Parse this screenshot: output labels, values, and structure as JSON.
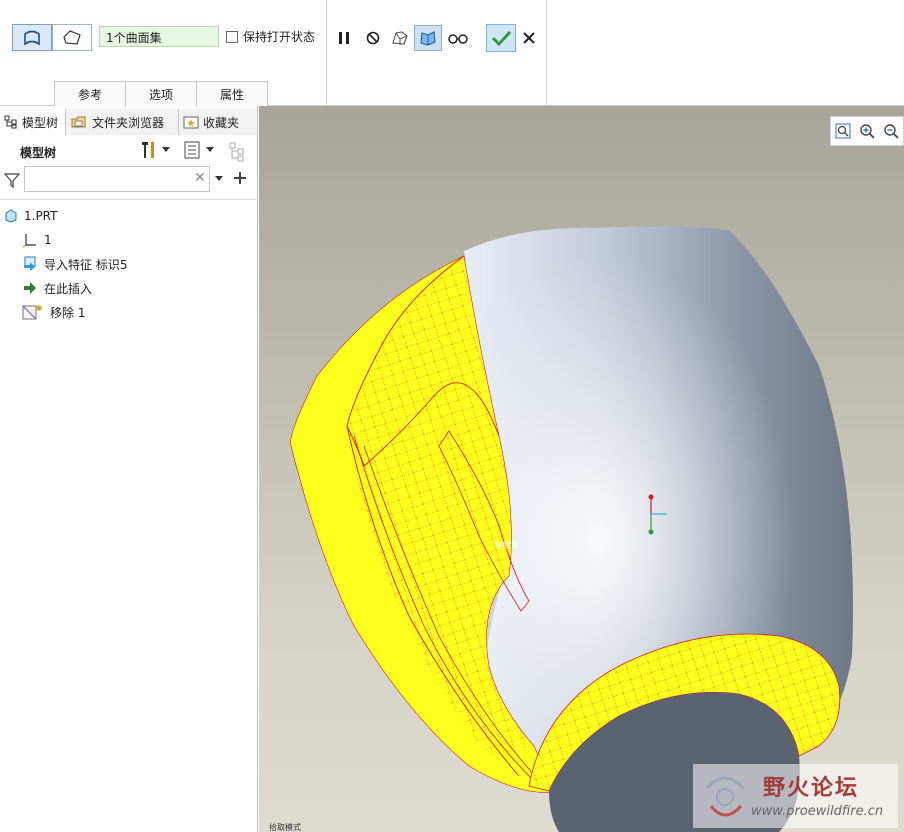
{
  "ribbon": {
    "collector_value": "1个曲面集",
    "keep_open_label": "保持打开状态",
    "tabs": [
      "参考",
      "选项",
      "属性"
    ]
  },
  "nav": {
    "tabs": [
      "模型树",
      "文件夹浏览器",
      "收藏夹"
    ]
  },
  "tree": {
    "title": "模型树",
    "filter_placeholder": "",
    "items": [
      {
        "label": "1.PRT",
        "icon": "part-icon"
      },
      {
        "label": "1",
        "icon": "coordinate-system-icon"
      },
      {
        "label": "导入特征 标识5",
        "icon": "import-feature-icon"
      },
      {
        "label": "在此插入",
        "icon": "insert-arrow-icon"
      },
      {
        "label": "移除 1",
        "icon": "remove-feature-icon"
      }
    ]
  },
  "viewport": {
    "model_label": "移除集",
    "bottom_label": "拾取模式",
    "watermark_title": "野火论坛",
    "watermark_url": "www.proewildfire.cn"
  },
  "colors": {
    "highlight_yellow": "#ffff1e",
    "mesh_red": "#d7192a",
    "body_gray": "#8d97a8",
    "accent_blue": "#2c73c4",
    "confirm_green": "#2e9b3a"
  }
}
